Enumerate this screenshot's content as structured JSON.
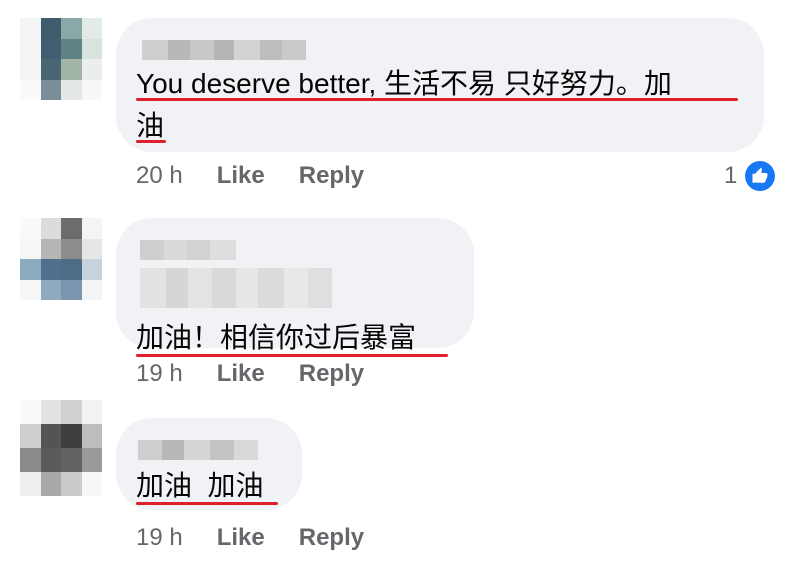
{
  "comments": [
    {
      "text_lines": [
        "You deserve better, 生活不易 只好努力。加",
        "油"
      ],
      "time": "20 h",
      "like_label": "Like",
      "reply_label": "Reply",
      "reaction_count": "1",
      "reaction_icon": "like-thumb-icon"
    },
    {
      "text_lines": [
        "加油！相信你过后暴富"
      ],
      "time": "19 h",
      "like_label": "Like",
      "reply_label": "Reply"
    },
    {
      "text_lines": [
        "加油  加油"
      ],
      "time": "19 h",
      "like_label": "Like",
      "reply_label": "Reply"
    }
  ],
  "colors": {
    "bubble_bg": "#f0f2f5",
    "meta_text": "#65676b",
    "underline": "#e0202a",
    "like_blue": "#1877f2"
  }
}
